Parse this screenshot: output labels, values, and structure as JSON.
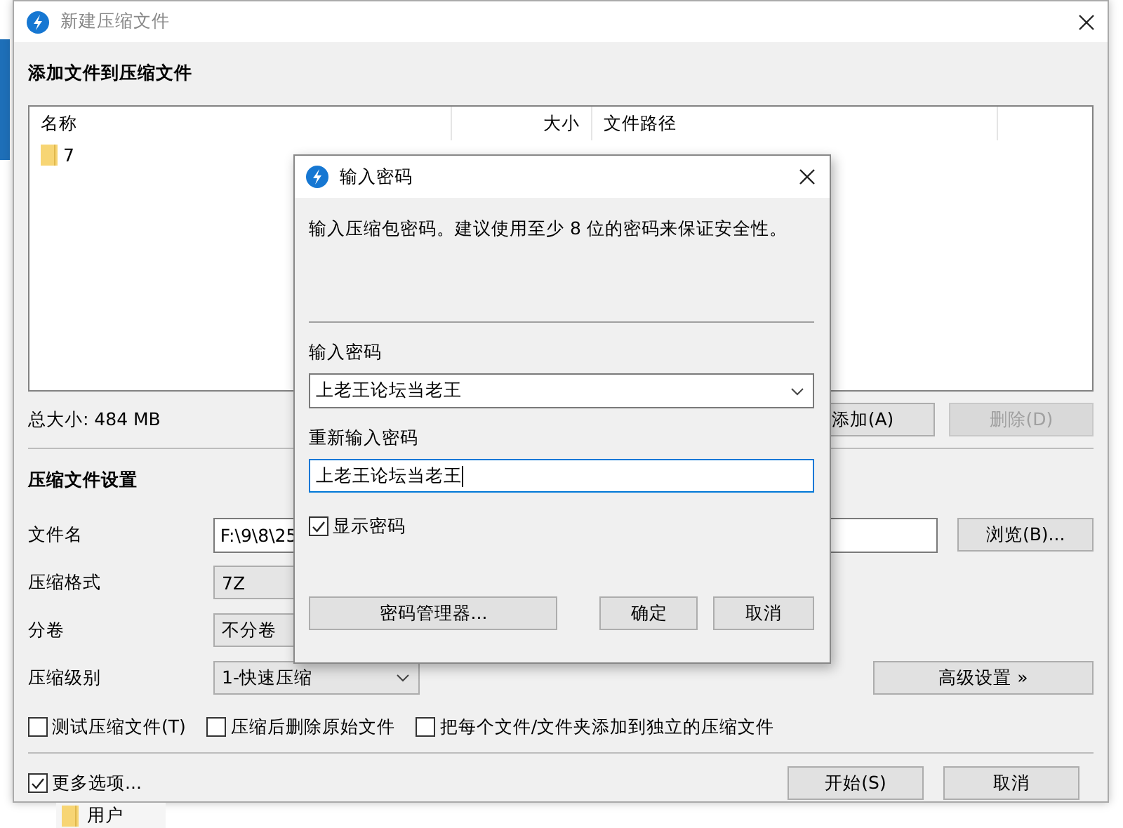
{
  "main_window": {
    "title": "新建压缩文件",
    "files": {
      "heading": "添加文件到压缩文件",
      "columns": [
        "名称",
        "大小",
        "文件路径"
      ],
      "rows": [
        {
          "name": "7"
        }
      ]
    },
    "total_size": "总大小: 484 MB",
    "list_buttons": [
      {
        "label": "添加(A)",
        "disabled": false
      },
      {
        "label": "删除(D)",
        "disabled": true
      }
    ],
    "settings": {
      "heading": "压缩文件设置",
      "fields": [
        {
          "label": "文件名",
          "kind": "text",
          "value": "F:\\9\\8\\25"
        },
        {
          "label": "压缩格式",
          "kind": "combo",
          "value": "7Z"
        },
        {
          "label": "分卷",
          "kind": "combo",
          "value": "不分卷"
        },
        {
          "label": "压缩级别",
          "kind": "combo",
          "value": "1-快速压缩"
        }
      ],
      "browse_button": "浏览(B)...",
      "advanced_button": "高级设置 »"
    },
    "options": [
      {
        "label": "测试压缩文件(T)",
        "checked": false
      },
      {
        "label": "压缩后删除原始文件",
        "checked": false
      },
      {
        "label": "把每个文件/文件夹添加到独立的压缩文件",
        "checked": false
      }
    ],
    "more_options": {
      "label": "更多选项...",
      "checked": true
    },
    "footer_buttons": [
      "开始(S)",
      "取消"
    ]
  },
  "password_dialog": {
    "title": "输入密码",
    "message": "输入压缩包密码。建议使用至少 8 位的密码来保证安全性。",
    "password_label": "输入密码",
    "password_value": "上老王论坛当老王",
    "confirm_label": "重新输入密码",
    "confirm_value": "上老王论坛当老王",
    "show_password": {
      "label": "显示密码",
      "checked": true
    },
    "buttons": [
      "密码管理器...",
      "确定",
      "取消"
    ]
  },
  "background": {
    "folder_label": "用户"
  }
}
